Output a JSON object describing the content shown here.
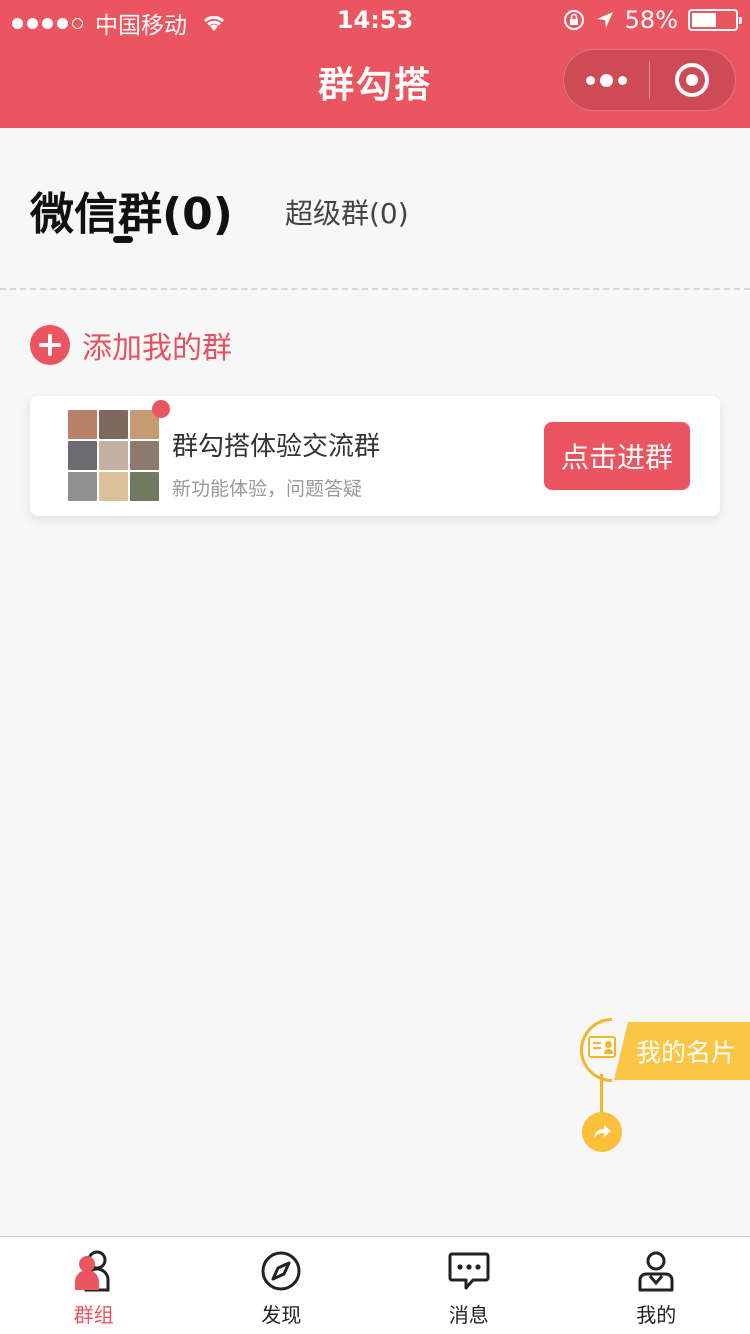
{
  "status_bar": {
    "carrier": "中国移动",
    "time": "14:53",
    "battery": "58%",
    "battery_level": 0.58
  },
  "nav": {
    "title": "群勾搭",
    "capsule_icons": [
      "more-dots-icon",
      "close-target-icon"
    ]
  },
  "tabs": {
    "active_label": "微信群(0)",
    "inactive_label": "超级群(0)"
  },
  "add_group": {
    "label": "添加我的群",
    "icon": "plus-circle-icon"
  },
  "groups": [
    {
      "name": "群勾搭体验交流群",
      "description": "新功能体验，问题答疑",
      "button_label": "点击进群",
      "has_badge": true
    }
  ],
  "float_card": {
    "label": "我的名片",
    "icons": [
      "business-card-icon",
      "share-icon"
    ]
  },
  "tabbar": {
    "items": [
      {
        "label": "群组",
        "icon": "group-icon",
        "active": true
      },
      {
        "label": "发现",
        "icon": "compass-icon",
        "active": false
      },
      {
        "label": "消息",
        "icon": "message-icon",
        "active": false
      },
      {
        "label": "我的",
        "icon": "profile-icon",
        "active": false
      }
    ]
  },
  "colors": {
    "primary": "#eb5560",
    "accent_yellow": "#fbc545",
    "background": "#f7f7f7"
  }
}
